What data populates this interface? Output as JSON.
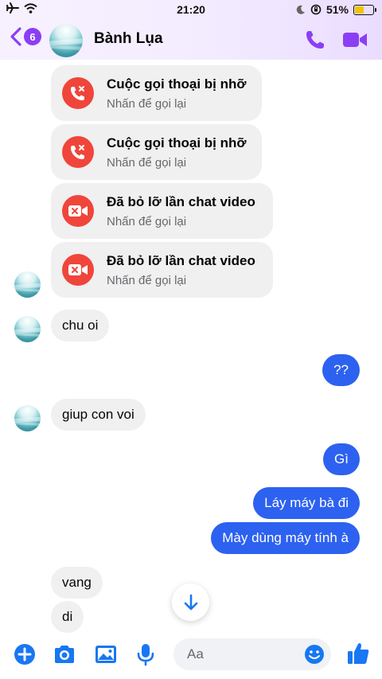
{
  "status_bar": {
    "time": "21:20",
    "battery": "51%",
    "battery_level": 0.51
  },
  "header": {
    "unread_count": "6",
    "contact_name": "Bành Lụa",
    "icons": [
      "back-arrow-icon",
      "phone-icon",
      "video-camera-icon"
    ],
    "accent_color": "#8b3ff4"
  },
  "call_events": [
    {
      "title": "Cuộc gọi thoại bị nhỡ",
      "subtitle": "Nhấn để gọi lại",
      "icon": "missed-call-icon"
    },
    {
      "title": "Cuộc gọi thoại bị nhỡ",
      "subtitle": "Nhấn để gọi lại",
      "icon": "missed-call-icon"
    },
    {
      "title": "Đã bỏ lỡ lần chat video",
      "subtitle": "Nhấn để gọi lại",
      "icon": "missed-video-icon"
    },
    {
      "title": "Đã bỏ lỡ lần chat video",
      "subtitle": "Nhấn để gọi lại",
      "icon": "missed-video-icon"
    }
  ],
  "messages": [
    {
      "from": "them",
      "text": "chu oi"
    },
    {
      "from": "me",
      "text": "??"
    },
    {
      "from": "them",
      "text": "giup con voi"
    },
    {
      "from": "me",
      "text": "Gì"
    },
    {
      "from": "me",
      "text": "Láy máy bà đi"
    },
    {
      "from": "me",
      "text": "Mày dùng máy tính à"
    },
    {
      "from": "them",
      "text": "vang"
    },
    {
      "from": "them",
      "text": "di"
    }
  ],
  "composer": {
    "placeholder": "Aa",
    "value": "",
    "icons": [
      "plus-icon",
      "camera-icon",
      "photo-icon",
      "microphone-icon",
      "emoji-icon",
      "thumbs-up-icon"
    ]
  },
  "colors": {
    "outgoing_bubble": "#2d61f0",
    "incoming_bubble": "#f0f0f0",
    "missed_call_red": "#f0453a",
    "composer_icon_blue": "#1877f2"
  }
}
